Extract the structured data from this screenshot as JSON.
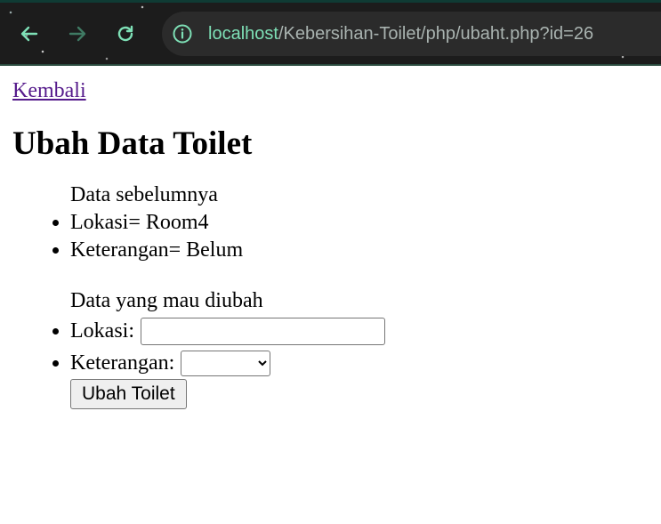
{
  "browser": {
    "url_host": "localhost",
    "url_path": "/Kebersihan-Toilet/php/ubaht.php?id=26",
    "accent_color": "#7ee0b6"
  },
  "page": {
    "back_link": "Kembali",
    "title": "Ubah Data Toilet"
  },
  "previous_data": {
    "label": "Data sebelumnya",
    "items": [
      "Lokasi= Room4",
      "Keterangan= Belum"
    ]
  },
  "new_data": {
    "label": "Data yang mau diubah",
    "lokasi_label": "Lokasi:",
    "lokasi_value": "",
    "keterangan_label": "Keterangan:",
    "keterangan_selected": "",
    "submit_label": "Ubah Toilet"
  }
}
